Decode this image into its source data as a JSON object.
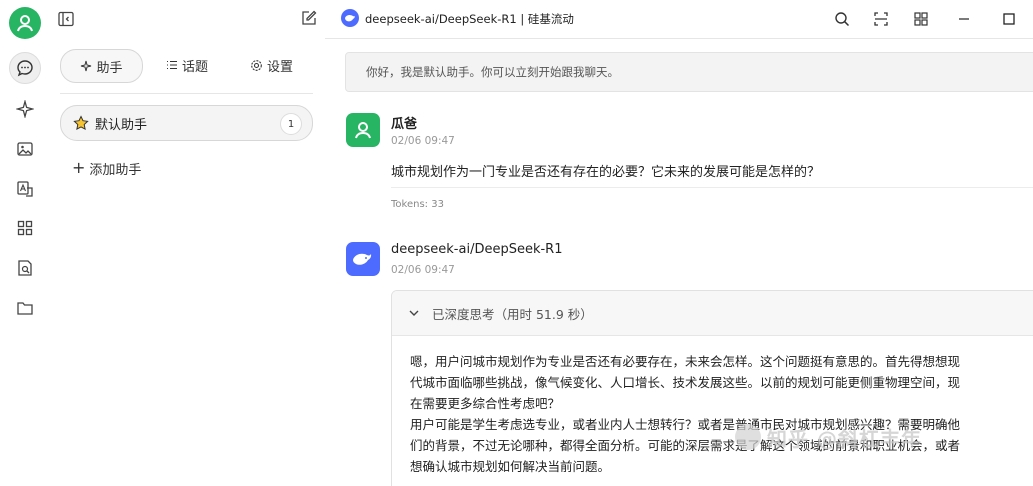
{
  "header": {
    "title": "deepseek-ai/DeepSeek-R1 | 硅基流动",
    "icons": [
      "search-icon",
      "expand-icon",
      "grid-icon",
      "minimize-icon",
      "maximize-icon"
    ]
  },
  "panel": {
    "tabs": [
      {
        "label": "助手",
        "icon": "sparkle-icon"
      },
      {
        "label": "话题",
        "icon": "list-icon"
      },
      {
        "label": "设置",
        "icon": "gear-icon"
      }
    ],
    "assistant": {
      "name": "默认助手",
      "count": "1"
    },
    "add_label": "添加助手"
  },
  "chat": {
    "system_message": "你好，我是默认助手。你可以立刻开始跟我聊天。",
    "user": {
      "name": "瓜爸",
      "time": "02/06 09:47",
      "text": "城市规划作为一门专业是否还有存在的必要？它未来的发展可能是怎样的？",
      "tokens": "Tokens: 33"
    },
    "model": {
      "name": "deepseek-ai/DeepSeek-R1",
      "time": "02/06 09:47",
      "think_title": "已深度思考（用时 51.9 秒）",
      "think_lines": [
        "嗯，用户问城市规划作为专业是否还有必要存在，未来会怎样。这个问题挺有意思的。首先得想想现",
        "代城市面临哪些挑战，像气候变化、人口增长、技术发展这些。以前的规划可能更侧重物理空间，现",
        "在需要更多综合性考虑吧？",
        "用户可能是学生考虑选专业，或者业内人士想转行？或者是普通市民对城市规划感兴趣？需要明确他",
        "们的背景，不过无论哪种，都得全面分析。可能的深层需求是了解这个领域的前景和职业机会，或者",
        "想确认城市规划如何解决当前问题。"
      ]
    }
  },
  "watermark": "知乎 @斜杠丰年",
  "colors": {
    "green": "#27b463",
    "deepseek_blue": "#4d6bfe"
  }
}
